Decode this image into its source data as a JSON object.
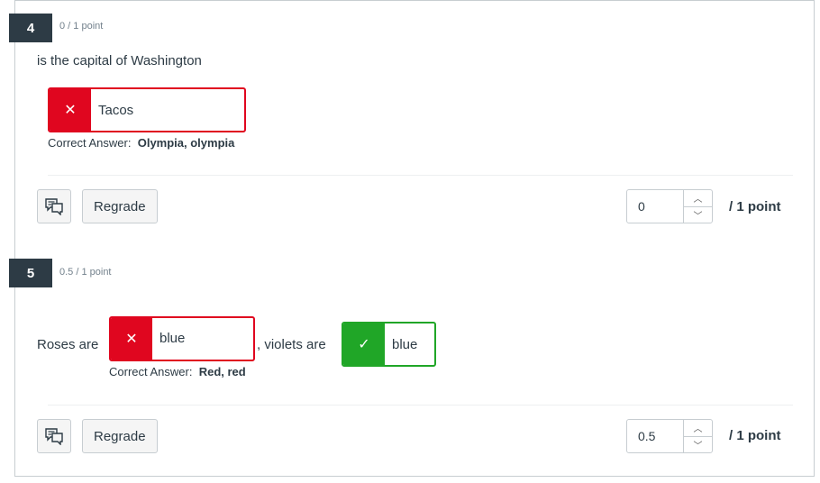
{
  "q4": {
    "number": "4",
    "points": "0 / 1 point",
    "text": "is the capital of Washington",
    "answer": "Tacos",
    "answer_mark": "✕",
    "correct_label": "Correct Answer:",
    "correct_value": "Olympia, olympia",
    "regrade": "Regrade",
    "score": "0",
    "points_label": "/ 1 point"
  },
  "q5": {
    "number": "5",
    "points": "0.5 / 1 point",
    "text_before": "Roses are",
    "answer1": "blue",
    "answer1_mark": "✕",
    "text_middle": ", violets are",
    "answer2": "blue",
    "answer2_mark": "✓",
    "correct_label": "Correct Answer:",
    "correct_value": "Red, red",
    "regrade": "Regrade",
    "score": "0.5",
    "points_label": "/ 1 point"
  },
  "icons": {
    "comment": "comment-icon",
    "up": "chevron-up-icon",
    "down": "chevron-down-icon"
  },
  "colors": {
    "incorrect": "#e0061f",
    "correct": "#20a627",
    "header": "#2d3b45"
  }
}
